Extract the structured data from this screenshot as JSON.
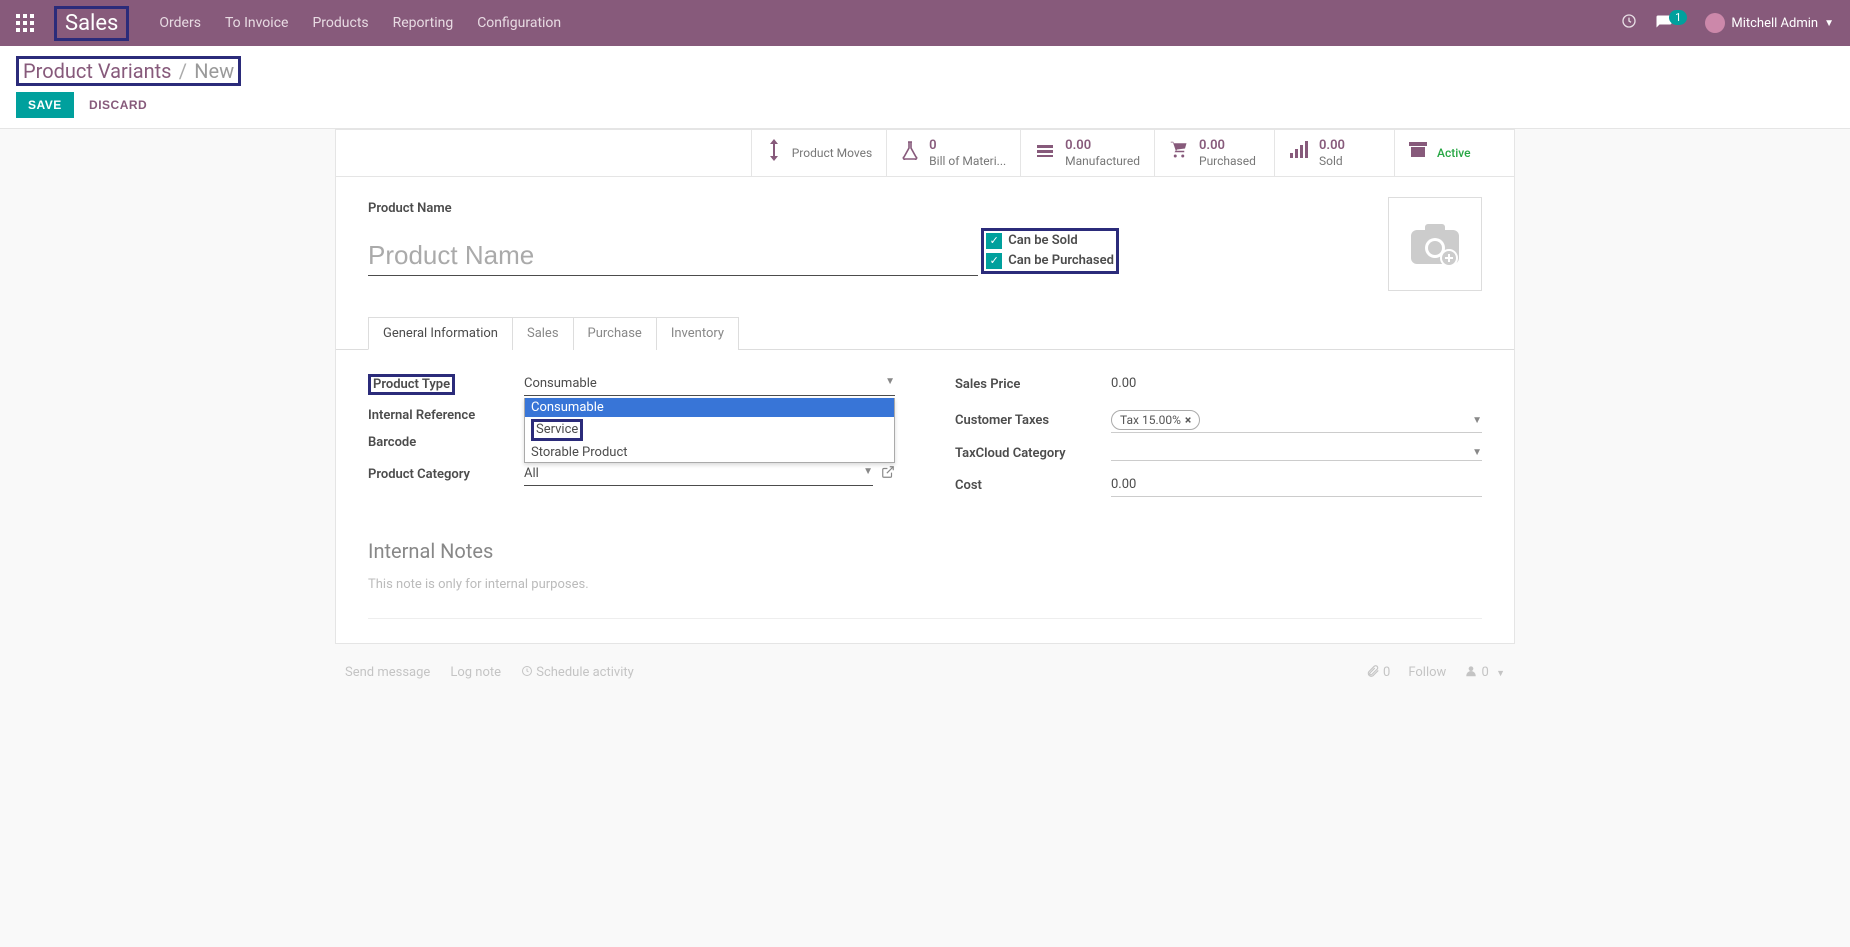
{
  "topbar": {
    "brand": "Sales",
    "nav": [
      "Orders",
      "To Invoice",
      "Products",
      "Reporting",
      "Configuration"
    ],
    "chat_count": "1",
    "user": "Mitchell Admin"
  },
  "breadcrumb": {
    "parent": "Product Variants",
    "sep": "/",
    "current": "New"
  },
  "actions": {
    "save": "SAVE",
    "discard": "DISCARD"
  },
  "stats": {
    "product_moves": "Product Moves",
    "bom_val": "0",
    "bom_lbl": "Bill of Materi...",
    "mfg_val": "0.00",
    "mfg_lbl": "Manufactured",
    "pur_val": "0.00",
    "pur_lbl": "Purchased",
    "sold_val": "0.00",
    "sold_lbl": "Sold",
    "active": "Active"
  },
  "product": {
    "name_label": "Product Name",
    "name_placeholder": "Product Name",
    "can_be_sold": "Can be Sold",
    "can_be_purchased": "Can be Purchased"
  },
  "tabs": [
    "General Information",
    "Sales",
    "Purchase",
    "Inventory"
  ],
  "gen": {
    "product_type_label": "Product Type",
    "product_type_value": "Consumable",
    "product_type_options": [
      "Consumable",
      "Service",
      "Storable Product"
    ],
    "internal_ref_label": "Internal Reference",
    "barcode_label": "Barcode",
    "category_label": "Product Category",
    "category_value": "All",
    "sales_price_label": "Sales Price",
    "sales_price_value": "0.00",
    "customer_taxes_label": "Customer Taxes",
    "customer_taxes_tag": "Tax 15.00%",
    "taxcloud_label": "TaxCloud Category",
    "cost_label": "Cost",
    "cost_value": "0.00"
  },
  "notes": {
    "heading": "Internal Notes",
    "placeholder": "This note is only for internal purposes."
  },
  "chatter": {
    "send": "Send message",
    "log": "Log note",
    "schedule": "Schedule activity",
    "attach_count": "0",
    "follow": "Follow",
    "followers": "0"
  }
}
